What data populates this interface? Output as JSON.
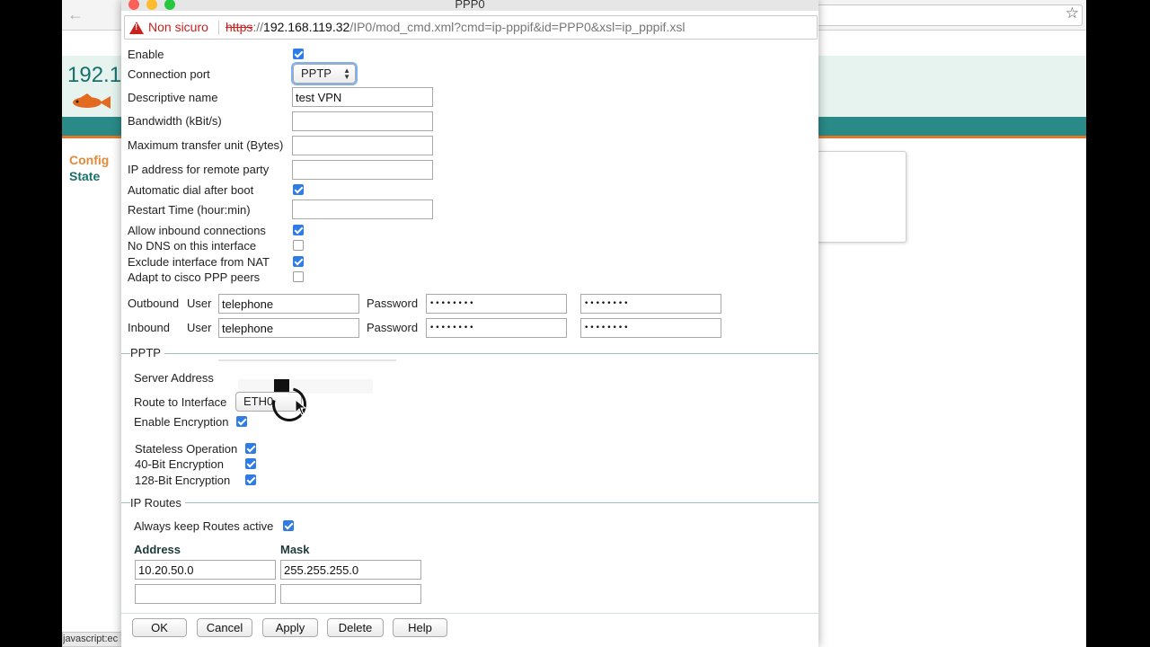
{
  "background": {
    "ip_partial": "192.1",
    "nav": {
      "config": "Config",
      "state": "State"
    },
    "status_text": "javascript:ec"
  },
  "window": {
    "title": "PPP0",
    "url_warning": "Non sicuro",
    "url_scheme": "https",
    "url_sep": "://",
    "url_host": "192.168.119.32",
    "url_path": "/IP0/mod_cmd.xml?cmd=ip-pppif&id=PPP0&xsl=ip_pppif.xsl"
  },
  "form": {
    "enable": {
      "label": "Enable",
      "checked": true
    },
    "connection_port": {
      "label": "Connection port",
      "value": "PPTP"
    },
    "descriptive_name": {
      "label": "Descriptive name",
      "value": "test VPN"
    },
    "bandwidth": {
      "label": "Bandwidth (kBit/s)",
      "value": ""
    },
    "mtu": {
      "label": "Maximum transfer unit (Bytes)",
      "value": ""
    },
    "remote_ip": {
      "label": "IP address for remote party",
      "value": ""
    },
    "auto_dial": {
      "label": "Automatic dial after boot",
      "checked": true
    },
    "restart_time": {
      "label": "Restart Time (hour:min)",
      "value": ""
    },
    "allow_inbound": {
      "label": "Allow inbound connections",
      "checked": true
    },
    "no_dns": {
      "label": "No DNS on this interface",
      "checked": false
    },
    "exclude_nat": {
      "label": "Exclude interface from NAT",
      "checked": true
    },
    "cisco_peers": {
      "label": "Adapt to cisco PPP peers",
      "checked": false
    },
    "outbound": {
      "label": "Outbound",
      "user_label": "User",
      "user": "telephone",
      "password_label": "Password",
      "password": "••••••••",
      "password_confirm": "••••••••"
    },
    "inbound": {
      "label": "Inbound",
      "user_label": "User",
      "user": "telephone",
      "password_label": "Password",
      "password": "••••••••",
      "password_confirm": "••••••••"
    }
  },
  "pptp": {
    "title": "PPTP",
    "server_address_label": "Server Address",
    "route_label": "Route to Interface",
    "route_value": "ETH0",
    "enable_encryption": {
      "label": "Enable Encryption",
      "checked": true
    },
    "stateless": {
      "label": "Stateless Operation",
      "checked": true
    },
    "bit40": {
      "label": "40-Bit Encryption",
      "checked": true
    },
    "bit128": {
      "label": "128-Bit Encryption",
      "checked": true
    }
  },
  "routes": {
    "title": "IP Routes",
    "keep_active": {
      "label": "Always keep Routes active",
      "checked": true
    },
    "headers": {
      "address": "Address",
      "mask": "Mask"
    },
    "rows": [
      {
        "address": "10.20.50.0",
        "mask": "255.255.255.0"
      },
      {
        "address": "",
        "mask": ""
      }
    ]
  },
  "buttons": {
    "ok": "OK",
    "cancel": "Cancel",
    "apply": "Apply",
    "delete": "Delete",
    "help": "Help"
  },
  "colors": {
    "accent": "#2a8a88",
    "warning": "#c9211e",
    "checkbox": "#2f7ce6",
    "orange": "#e07a2a"
  }
}
